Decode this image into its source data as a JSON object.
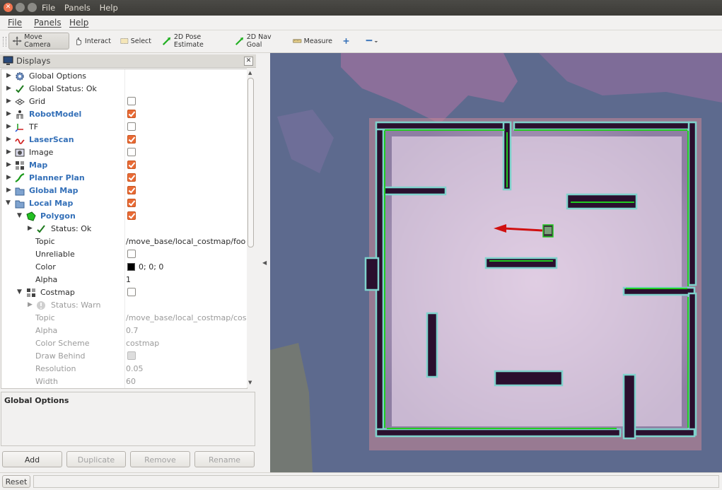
{
  "window": {
    "menu": [
      "File",
      "Panels",
      "Help"
    ]
  },
  "menubar": {
    "file": "File",
    "panels": "Panels",
    "help": "Help"
  },
  "toolbar": {
    "move_camera": "Move Camera",
    "interact": "Interact",
    "select": "Select",
    "pose_estimate": "2D Pose Estimate",
    "nav_goal": "2D Nav Goal",
    "measure": "Measure"
  },
  "displays": {
    "title": "Displays",
    "rows": [
      {
        "label": "Global Options",
        "value": "",
        "check": null
      },
      {
        "label": "Global Status: Ok",
        "value": "",
        "check": null
      },
      {
        "label": "Grid",
        "value": "",
        "check": false
      },
      {
        "label": "RobotModel",
        "value": "",
        "check": true
      },
      {
        "label": "TF",
        "value": "",
        "check": false
      },
      {
        "label": "LaserScan",
        "value": "",
        "check": true
      },
      {
        "label": "Image",
        "value": "",
        "check": false
      },
      {
        "label": "Map",
        "value": "",
        "check": true
      },
      {
        "label": "Planner Plan",
        "value": "",
        "check": true
      },
      {
        "label": "Global Map",
        "value": "",
        "check": true
      },
      {
        "label": "Local Map",
        "value": "",
        "check": true
      },
      {
        "label": "Polygon",
        "value": "",
        "check": true
      },
      {
        "label": "Status: Ok",
        "value": "",
        "check": null
      },
      {
        "label": "Topic",
        "value": "/move_base/local_costmap/foo...",
        "check": null
      },
      {
        "label": "Unreliable",
        "value": "",
        "check": false
      },
      {
        "label": "Color",
        "value": "0; 0; 0",
        "check": null
      },
      {
        "label": "Alpha",
        "value": "1",
        "check": null
      },
      {
        "label": "Costmap",
        "value": "",
        "check": false
      },
      {
        "label": "Status: Warn",
        "value": "",
        "check": null
      },
      {
        "label": "Topic",
        "value": "/move_base/local_costmap/cos...",
        "check": null
      },
      {
        "label": "Alpha",
        "value": "0.7",
        "check": null
      },
      {
        "label": "Color Scheme",
        "value": "costmap",
        "check": null
      },
      {
        "label": "Draw Behind",
        "value": "",
        "check": false
      },
      {
        "label": "Resolution",
        "value": "0.05",
        "check": null
      },
      {
        "label": "Width",
        "value": "60",
        "check": null
      }
    ]
  },
  "description": {
    "title": "Global Options"
  },
  "buttons": {
    "add": "Add",
    "duplicate": "Duplicate",
    "remove": "Remove",
    "rename": "Rename"
  },
  "statusbar": {
    "reset": "Reset"
  },
  "colors": {
    "accent": "#e96a35",
    "link": "#3470b8",
    "map_bg": "#5d6a8e",
    "costmap_free": "#e5cfe2",
    "obstacle": "#2a0f2e",
    "inflation": "#7fd2cc",
    "laser": "#22cc22",
    "path_arrow": "#d01010"
  }
}
